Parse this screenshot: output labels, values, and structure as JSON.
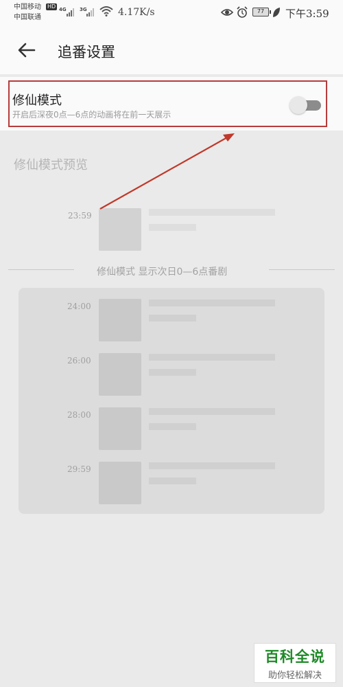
{
  "status_bar": {
    "carrier1": "中国移动",
    "carrier2": "中国联通",
    "hd": "HD",
    "net1": "4G",
    "net2": "3G",
    "speed": "4.17K/s",
    "battery": "77",
    "time": "下午3:59"
  },
  "header": {
    "title": "追番设置"
  },
  "setting": {
    "title": "修仙模式",
    "description": "开启后深夜0点—6点的动画将在前一天展示",
    "enabled": false
  },
  "preview": {
    "title": "修仙模式预览",
    "first_time": "23:59",
    "divider_label": "修仙模式 显示次日0—6点番剧",
    "next_day_times": [
      "24:00",
      "26:00",
      "28:00",
      "29:59"
    ]
  },
  "watermark": {
    "title": "百科全说",
    "subtitle": "助你轻松解决"
  },
  "colors": {
    "highlight": "#b73b3b",
    "arrow": "#c0392b",
    "watermark_green": "#1f8a28"
  }
}
